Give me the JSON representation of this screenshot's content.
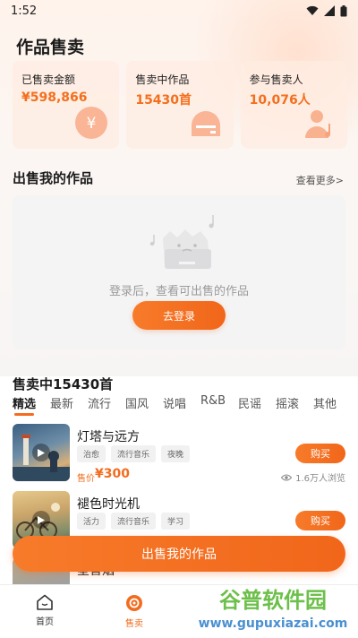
{
  "status_bar": {
    "time": "1:52"
  },
  "page": {
    "title": "作品售卖"
  },
  "stats": [
    {
      "label": "已售卖金额",
      "value": "¥598,866",
      "icon": "yen-icon"
    },
    {
      "label": "售卖中作品",
      "value": "15430首",
      "icon": "record-player-icon"
    },
    {
      "label": "参与售卖人",
      "value": "10,076人",
      "icon": "person-music-icon"
    }
  ],
  "my_works": {
    "title": "出售我的作品",
    "more": "查看更多>",
    "empty_text": "登录后，查看可出售的作品",
    "login_button": "去登录"
  },
  "on_sale": {
    "title": "售卖中15430首"
  },
  "tabs": [
    "精选",
    "最新",
    "流行",
    "国风",
    "说唱",
    "R&B",
    "民谣",
    "摇滚",
    "其他"
  ],
  "items": [
    {
      "title": "灯塔与远方",
      "tags": [
        "治愈",
        "流行音乐",
        "夜晚"
      ],
      "price_label": "售价",
      "price": "¥300",
      "views": "1.6万人浏览",
      "buy": "购买"
    },
    {
      "title": "褪色时光机",
      "tags": [
        "活力",
        "流行音乐",
        "学习"
      ],
      "buy": "购买"
    },
    {
      "title": "星音烟"
    }
  ],
  "sell_button": "出售我的作品",
  "nav": [
    {
      "label": "首页",
      "icon": "home-icon"
    },
    {
      "label": "售卖",
      "icon": "sell-icon"
    }
  ],
  "watermark": {
    "text": "谷普软件园",
    "url": "www.gupuxiazai.com"
  },
  "colors": {
    "accent": "#f26c1f",
    "card_bg": "#ffece2"
  }
}
